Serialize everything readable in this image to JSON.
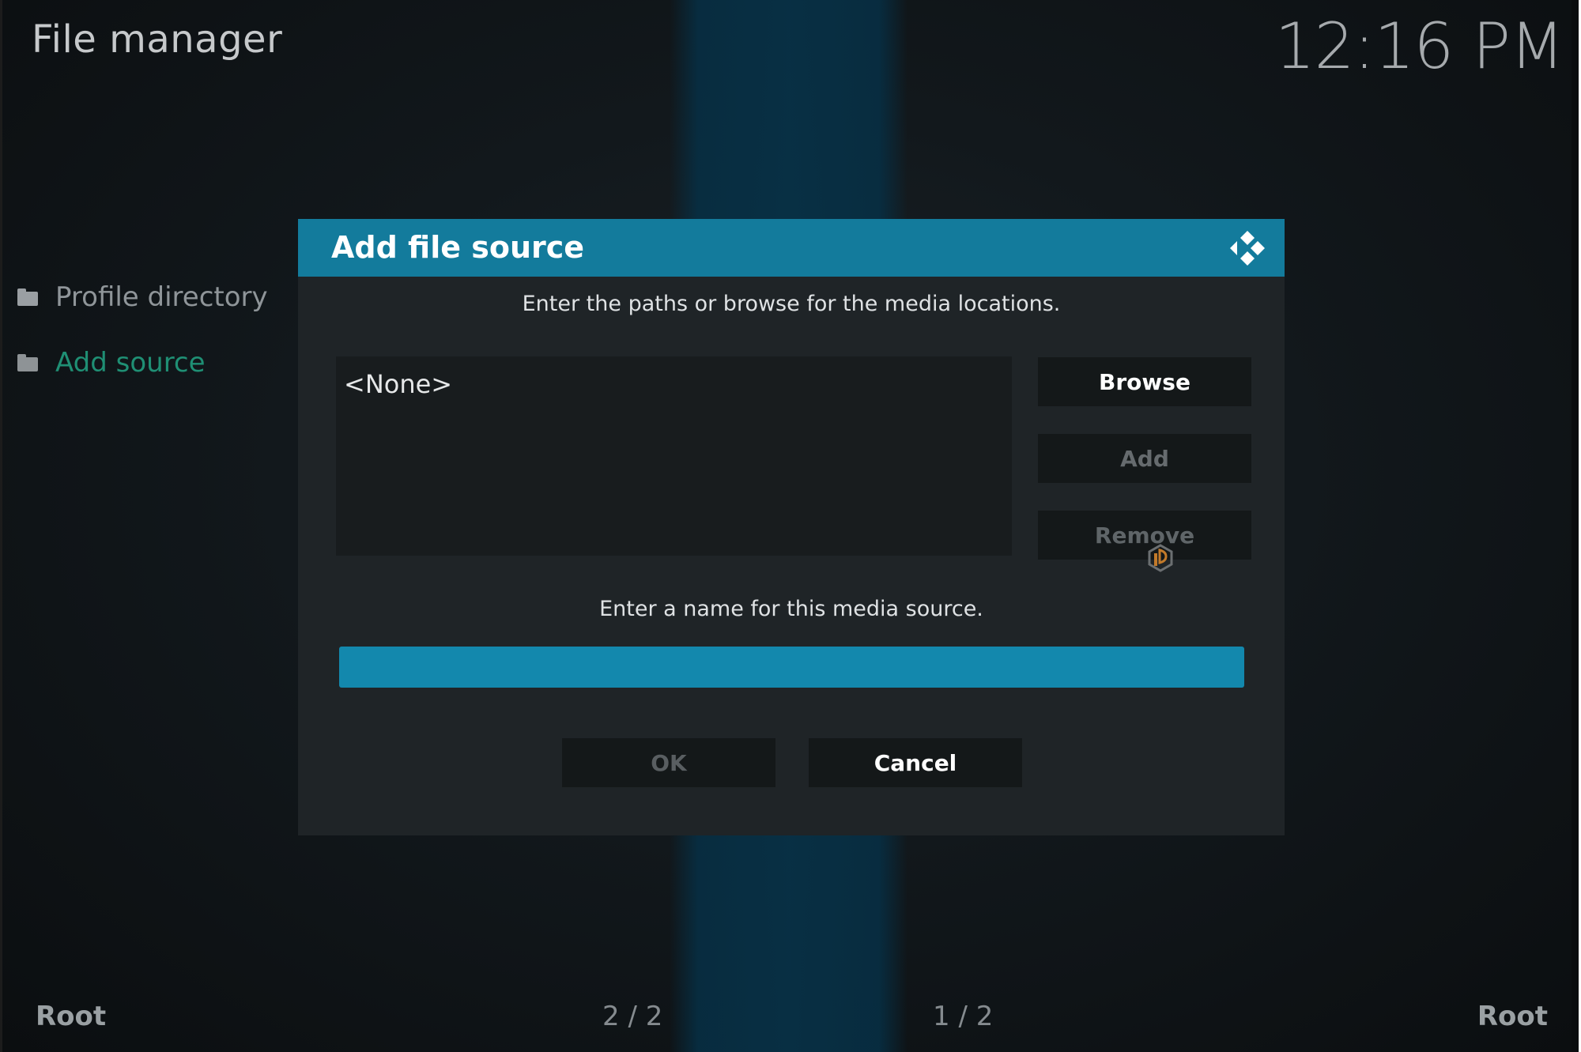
{
  "header": {
    "title": "File manager",
    "clock": "12:16 PM"
  },
  "sidebar": {
    "items": [
      {
        "label": "Profile directory",
        "icon": "folder-icon",
        "active": false
      },
      {
        "label": "Add source",
        "icon": "folder-icon",
        "active": true
      }
    ]
  },
  "dialog": {
    "title": "Add file source",
    "logo_icon": "kodi-logo-icon",
    "paths_instruction": "Enter the paths or browse for the media locations.",
    "paths": [
      "<None>"
    ],
    "buttons": {
      "browse": "Browse",
      "add": "Add",
      "remove": "Remove"
    },
    "name_instruction": "Enter a name for this media source.",
    "name_value": "",
    "ok": "OK",
    "cancel": "Cancel"
  },
  "footer": {
    "left_label": "Root",
    "left_count": "2 / 2",
    "right_count": "1 / 2",
    "right_label": "Root"
  },
  "colors": {
    "accent": "#137b9c",
    "input_focus": "#1388ad",
    "active_item": "#1f8f74"
  }
}
